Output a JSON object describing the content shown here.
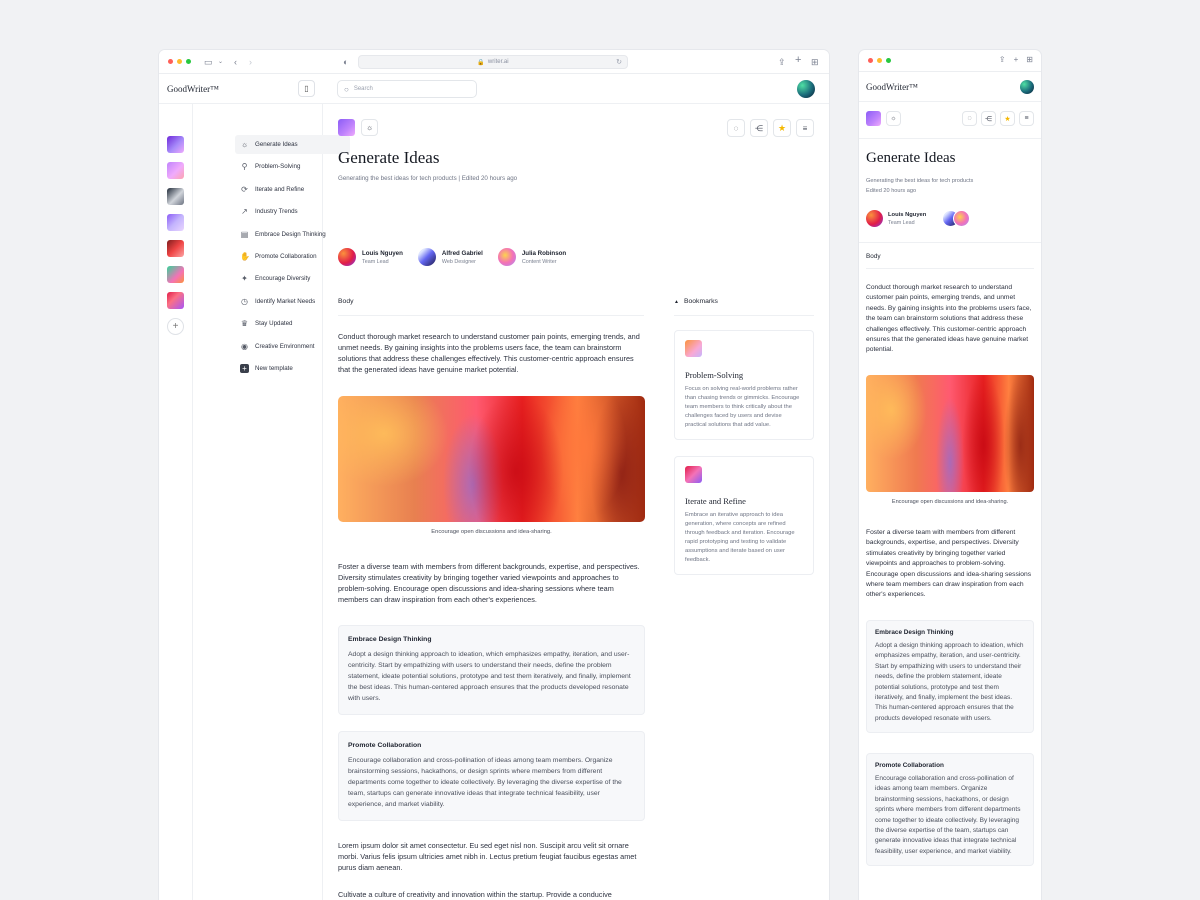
{
  "browser": {
    "url": "writer.ai"
  },
  "app": {
    "brand": "GoodWriter™"
  },
  "search": {
    "placeholder": "Search"
  },
  "rail": {
    "colors": [
      "#a78bfa",
      "#f0abfc",
      "#9ca3af",
      "#c4b5fd",
      "#ef4444",
      "#f472b6",
      "#fb7185"
    ]
  },
  "sidebar": {
    "items": [
      {
        "label": "Generate Ideas",
        "icon": "sun-icon"
      },
      {
        "label": "Problem-Solving",
        "icon": "puzzle-icon"
      },
      {
        "label": "Iterate and Refine",
        "icon": "refresh-icon"
      },
      {
        "label": "Industry Trends",
        "icon": "trend-icon"
      },
      {
        "label": "Embrace Design Thinking",
        "icon": "document-icon"
      },
      {
        "label": "Promote Collaboration",
        "icon": "hand-icon"
      },
      {
        "label": "Encourage Diversity",
        "icon": "star-icon"
      },
      {
        "label": "Identify Market Needs",
        "icon": "timer-icon"
      },
      {
        "label": "Stay Updated",
        "icon": "trophy-icon"
      },
      {
        "label": "Creative Environment",
        "icon": "broadcast-icon"
      },
      {
        "label": "New template",
        "icon": "plus-icon"
      }
    ]
  },
  "page": {
    "title": "Generate Ideas",
    "subtitle": "Generating the best ideas for tech products | Edited 20 hours ago",
    "mobile_subtitle_1": "Generating the best ideas for tech products",
    "mobile_subtitle_2": "Edited 20 hours ago",
    "authors": [
      {
        "name": "Louis Nguyen",
        "role": "Team Lead"
      },
      {
        "name": "Alfred Gabriel",
        "role": "Web Designer"
      },
      {
        "name": "Julia Robinson",
        "role": "Content Writer"
      }
    ],
    "body_label": "Body",
    "bookmarks_label": "Bookmarks",
    "para1": "Conduct thorough market research to understand customer pain points, emerging trends, and unmet needs. By gaining insights into the problems users face, the team can brainstorm solutions that address these challenges effectively. This customer-centric approach ensures that the generated ideas have genuine market potential.",
    "caption": "Encourage open discussions and idea-sharing.",
    "para2": "Foster a diverse team with members from different backgrounds, expertise, and perspectives. Diversity stimulates creativity by bringing together varied viewpoints and approaches to problem-solving. Encourage open discussions and idea-sharing sessions where team members can draw inspiration from each other's experiences.",
    "callout1": {
      "title": "Embrace Design Thinking",
      "text": "Adopt a design thinking approach to ideation, which emphasizes empathy, iteration, and user-centricity. Start by empathizing with users to understand their needs, define the problem statement, ideate potential solutions, prototype and test them iteratively, and finally, implement the best ideas. This human-centered approach ensures that the products developed resonate with users."
    },
    "callout2": {
      "title": "Promote Collaboration",
      "text": "Encourage collaboration and cross-pollination of ideas among team members. Organize brainstorming sessions, hackathons, or design sprints where members from different departments come together to ideate collectively. By leveraging the diverse expertise of the team, startups can generate innovative ideas that integrate technical feasibility, user experience, and market viability."
    },
    "para3": "Lorem ipsum dolor sit amet consectetur. Eu sed eget nisl non. Suscipit arcu velit sit ornare morbi. Varius felis ipsum ultricies amet nibh in. Lectus pretium feugiat faucibus egestas amet purus diam aenean.",
    "para4": "Cultivate a culture of creativity and innovation within the startup. Provide a conducive workspace that sparks creativity, whether it's through colorful decor, comfortable seating arrangements, or brainstorming areas. Encourage experimentation and risk-taking by fostering a non-judgmental atmosphere where every idea is valued."
  },
  "bookmarks": [
    {
      "title": "Problem-Solving",
      "text": "Focus on solving real-world problems rather than chasing trends or gimmicks. Encourage team members to think critically about the challenges faced by users and devise practical solutions that add value."
    },
    {
      "title": "Iterate and Refine",
      "text": "Embrace an iterative approach to idea generation, where concepts are refined through feedback and iteration. Encourage rapid prototyping and testing to validate assumptions and iterate based on user feedback."
    }
  ],
  "colors": {
    "star": "#f5b800",
    "accent": "#8b5cf6"
  }
}
